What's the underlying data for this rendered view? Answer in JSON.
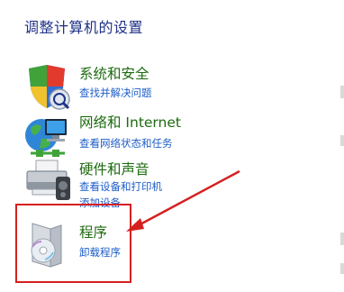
{
  "panel": {
    "heading": "调整计算机的设置"
  },
  "categories": [
    {
      "title": "系统和安全",
      "links": [
        "查找并解决问题"
      ],
      "icon": "shield-icon"
    },
    {
      "title": "网络和 Internet",
      "links": [
        "查看网络状态和任务"
      ],
      "icon": "network-globe-icon"
    },
    {
      "title": "硬件和声音",
      "links": [
        "查看设备和打印机",
        "添加设备"
      ],
      "icon": "printer-icon"
    },
    {
      "title": "程序",
      "links": [
        "卸载程序"
      ],
      "icon": "programs-cd-icon"
    }
  ],
  "annotation": {
    "color": "#d62020"
  }
}
